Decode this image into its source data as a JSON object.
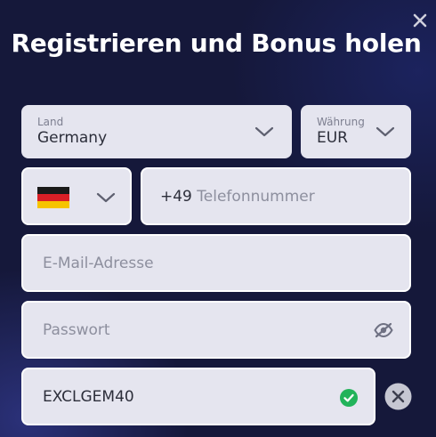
{
  "title": "Registrieren und Bonus holen",
  "country": {
    "label": "Land",
    "value": "Germany"
  },
  "currency": {
    "label": "Währung",
    "value": "EUR"
  },
  "phone": {
    "flag": "germany-flag",
    "prefix": "+49",
    "placeholder": "Telefonnummer"
  },
  "email": {
    "placeholder": "E-Mail-Adresse"
  },
  "password": {
    "placeholder": "Passwort"
  },
  "promo": {
    "value": "EXCLGEM40",
    "valid": true
  },
  "colors": {
    "background": "#15183a",
    "field": "#e5e5ef",
    "valid": "#22b35a",
    "clear_button": "#c6c7d2"
  }
}
